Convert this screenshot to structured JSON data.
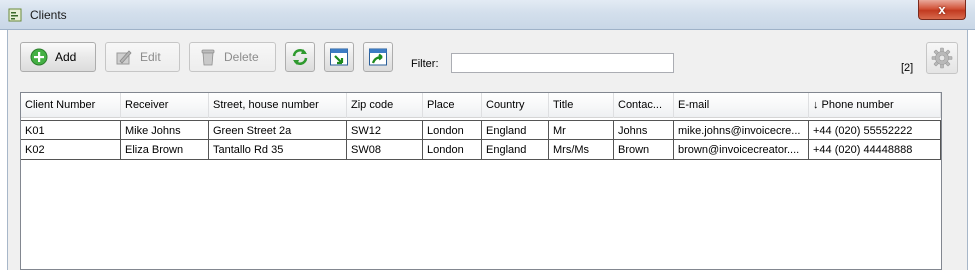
{
  "window": {
    "title": "Clients",
    "close_label": "x"
  },
  "toolbar": {
    "add_label": "Add",
    "edit_label": "Edit",
    "delete_label": "Delete",
    "filter_label": "Filter:",
    "filter_value": "",
    "count_label": "[2]"
  },
  "table": {
    "columns": [
      "Client Number",
      "Receiver",
      "Street, house number",
      "Zip code",
      "Place",
      "Country",
      "Title",
      "Contac...",
      "E-mail",
      "↓ Phone number"
    ],
    "rows": [
      [
        "K01",
        "Mike Johns",
        "Green Street 2a",
        "SW12",
        "London",
        "England",
        "Mr",
        "Johns",
        "mike.johns@invoicecre...",
        "+44 (020) 55552222"
      ],
      [
        "K02",
        "Eliza Brown",
        "Tantallo Rd 35",
        "SW08",
        "London",
        "England",
        "Mrs/Ms",
        "Brown",
        "brown@invoicecreator....",
        "+44 (020) 44448888"
      ]
    ]
  },
  "icons": {
    "app": "clients-app-icon",
    "add": "add-plus-icon",
    "edit": "edit-pencil-icon",
    "delete": "trash-icon",
    "refresh": "refresh-icon",
    "import": "import-icon",
    "export": "export-icon",
    "settings": "gear-icon"
  },
  "colors": {
    "accent_green": "#3aa73a",
    "close_red": "#c23a20"
  }
}
